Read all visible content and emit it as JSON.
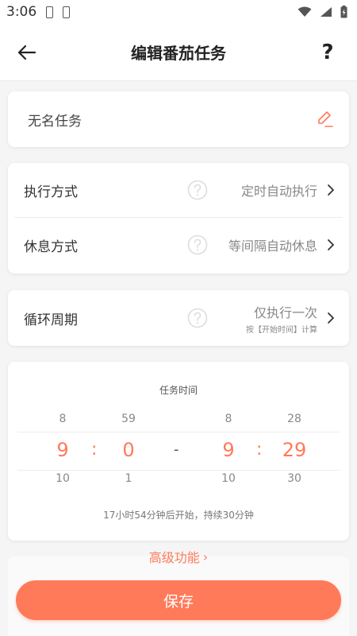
{
  "status_bar": {
    "time": "3:06"
  },
  "header": {
    "title": "编辑番茄任务",
    "help": "?"
  },
  "task": {
    "name": "无名任务"
  },
  "settings": {
    "execution": {
      "label": "执行方式",
      "value": "定时自动执行"
    },
    "rest": {
      "label": "休息方式",
      "value": "等间隔自动休息"
    },
    "cycle": {
      "label": "循环周期",
      "value": "仅执行一次",
      "sub": "按【开始时间】计算"
    }
  },
  "time": {
    "title": "任务时间",
    "start_hour": {
      "prev": "8",
      "value": "9",
      "next": "10"
    },
    "start_minute": {
      "prev": "59",
      "value": "0",
      "next": "1"
    },
    "end_hour": {
      "prev": "8",
      "value": "9",
      "next": "10"
    },
    "end_minute": {
      "prev": "28",
      "value": "29",
      "next": "30"
    },
    "separator": ":",
    "dash": "-",
    "note": "17小时54分钟后开始，持续30分钟"
  },
  "advanced": {
    "label": "高级功能",
    "chevron": "›"
  },
  "save": {
    "label": "保存"
  },
  "colors": {
    "accent": "#ff7a59"
  }
}
